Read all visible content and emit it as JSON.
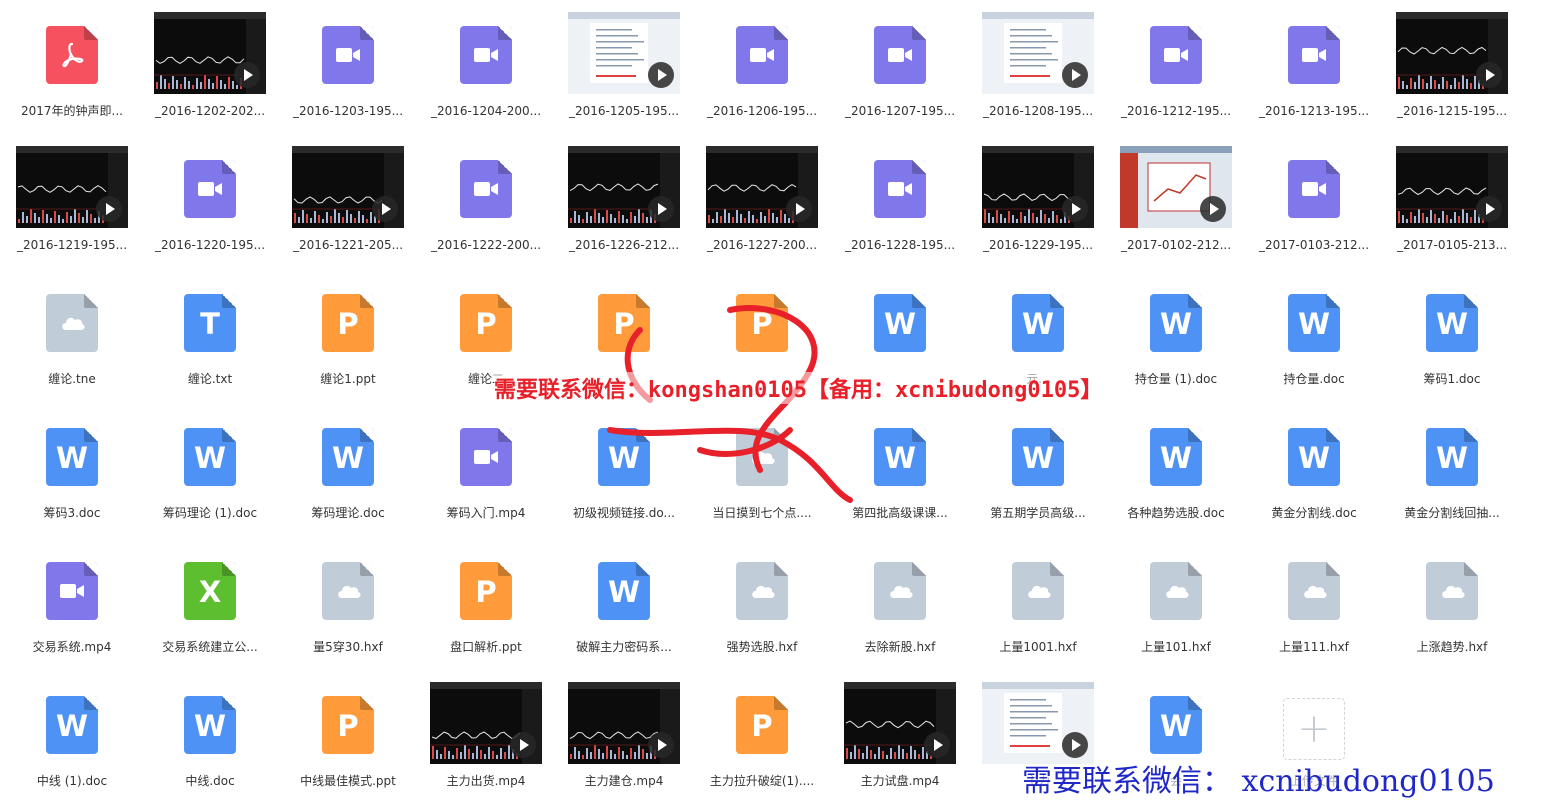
{
  "colors": {
    "pdf": "#f5515e",
    "video": "#8078ea",
    "ppt": "#ff9b3b",
    "word": "#4e92f5",
    "excel": "#5dbe2f",
    "txt": "#4e92f5",
    "cloud": "#c1ccd9",
    "watermark_top": "#e8202a",
    "watermark_bottom": "#1f28c7"
  },
  "files": [
    {
      "name": "2017年的钟声即...",
      "type": "pdf"
    },
    {
      "name": "_2016-1202-202...",
      "type": "thumb",
      "style": "dark"
    },
    {
      "name": "_2016-1203-195...",
      "type": "video"
    },
    {
      "name": "_2016-1204-200...",
      "type": "video"
    },
    {
      "name": "_2016-1205-195...",
      "type": "thumb",
      "style": "light"
    },
    {
      "name": "_2016-1206-195...",
      "type": "video"
    },
    {
      "name": "_2016-1207-195...",
      "type": "video"
    },
    {
      "name": "_2016-1208-195...",
      "type": "thumb",
      "style": "light"
    },
    {
      "name": "_2016-1212-195...",
      "type": "video"
    },
    {
      "name": "_2016-1213-195...",
      "type": "video"
    },
    {
      "name": "_2016-1215-195...",
      "type": "thumb",
      "style": "dark"
    },
    {
      "name": "_2016-1219-195...",
      "type": "thumb",
      "style": "dark"
    },
    {
      "name": "_2016-1220-195...",
      "type": "video"
    },
    {
      "name": "_2016-1221-205...",
      "type": "thumb",
      "style": "dark"
    },
    {
      "name": "_2016-1222-200...",
      "type": "video"
    },
    {
      "name": "_2016-1226-212...",
      "type": "thumb",
      "style": "dark"
    },
    {
      "name": "_2016-1227-200...",
      "type": "thumb",
      "style": "dark"
    },
    {
      "name": "_2016-1228-195...",
      "type": "video"
    },
    {
      "name": "_2016-1229-195...",
      "type": "thumb",
      "style": "dark"
    },
    {
      "name": "_2017-0102-212...",
      "type": "thumb",
      "style": "light2"
    },
    {
      "name": "_2017-0103-212...",
      "type": "video"
    },
    {
      "name": "_2017-0105-213...",
      "type": "thumb",
      "style": "dark"
    },
    {
      "name": "缠论.tne",
      "type": "cloud"
    },
    {
      "name": "缠论.txt",
      "type": "txt",
      "letter": "T"
    },
    {
      "name": "缠论1.ppt",
      "type": "ppt",
      "letter": "P"
    },
    {
      "name": "缠论二",
      "type": "ppt",
      "letter": "P"
    },
    {
      "name": "",
      "type": "ppt",
      "letter": "P"
    },
    {
      "name": "",
      "type": "ppt",
      "letter": "P"
    },
    {
      "name": "",
      "type": "word",
      "letter": "W"
    },
    {
      "name": "亓...",
      "type": "word",
      "letter": "W"
    },
    {
      "name": "持仓量 (1).doc",
      "type": "word",
      "letter": "W"
    },
    {
      "name": "持仓量.doc",
      "type": "word",
      "letter": "W"
    },
    {
      "name": "筹码1.doc",
      "type": "word",
      "letter": "W"
    },
    {
      "name": "筹码3.doc",
      "type": "word",
      "letter": "W"
    },
    {
      "name": "筹码理论 (1).doc",
      "type": "word",
      "letter": "W"
    },
    {
      "name": "筹码理论.doc",
      "type": "word",
      "letter": "W"
    },
    {
      "name": "筹码入门.mp4",
      "type": "video"
    },
    {
      "name": "初级视频链接.do...",
      "type": "word",
      "letter": "W"
    },
    {
      "name": "当日摸到七个点....",
      "type": "cloud"
    },
    {
      "name": "第四批高级课课...",
      "type": "word",
      "letter": "W"
    },
    {
      "name": "第五期学员高级...",
      "type": "word",
      "letter": "W"
    },
    {
      "name": "各种趋势选股.doc",
      "type": "word",
      "letter": "W"
    },
    {
      "name": "黄金分割线.doc",
      "type": "word",
      "letter": "W"
    },
    {
      "name": "黄金分割线回抽...",
      "type": "word",
      "letter": "W"
    },
    {
      "name": "交易系统.mp4",
      "type": "video"
    },
    {
      "name": "交易系统建立公...",
      "type": "excel",
      "letter": "X"
    },
    {
      "name": "量5穿30.hxf",
      "type": "cloud"
    },
    {
      "name": "盘口解析.ppt",
      "type": "ppt",
      "letter": "P"
    },
    {
      "name": "破解主力密码系...",
      "type": "word",
      "letter": "W"
    },
    {
      "name": "强势选股.hxf",
      "type": "cloud"
    },
    {
      "name": "去除新股.hxf",
      "type": "cloud"
    },
    {
      "name": "上量1001.hxf",
      "type": "cloud"
    },
    {
      "name": "上量101.hxf",
      "type": "cloud"
    },
    {
      "name": "上量111.hxf",
      "type": "cloud"
    },
    {
      "name": "上涨趋势.hxf",
      "type": "cloud"
    },
    {
      "name": "中线 (1).doc",
      "type": "word",
      "letter": "W"
    },
    {
      "name": "中线.doc",
      "type": "word",
      "letter": "W"
    },
    {
      "name": "中线最佳模式.ppt",
      "type": "ppt",
      "letter": "P"
    },
    {
      "name": "主力出货.mp4",
      "type": "thumb",
      "style": "dark"
    },
    {
      "name": "主力建仓.mp4",
      "type": "thumb",
      "style": "dark"
    },
    {
      "name": "主力拉升破绽(1)....",
      "type": "ppt",
      "letter": "P"
    },
    {
      "name": "主力试盘.mp4",
      "type": "thumb",
      "style": "dark"
    },
    {
      "name": "主力",
      "type": "thumb",
      "style": "light"
    },
    {
      "name": "会",
      "type": "word",
      "letter": "W"
    },
    {
      "name": "上传文件",
      "type": "upload"
    }
  ],
  "watermark_top": "需要联系微信：kongshan0105【备用：xcnibudong0105】",
  "watermark_bottom": "需要联系微信： xcnibudong0105"
}
